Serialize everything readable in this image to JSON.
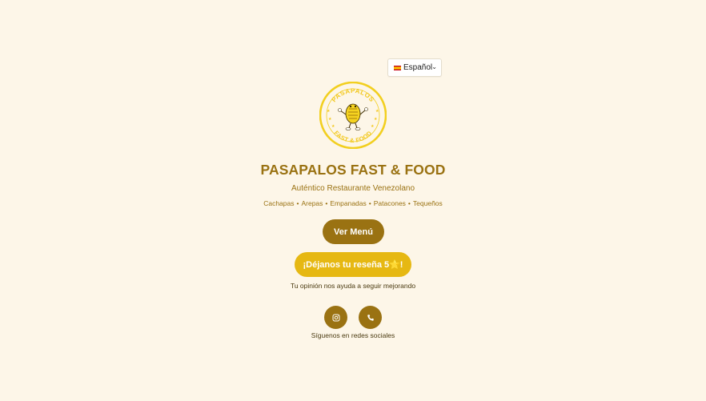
{
  "language_selector": {
    "flag_icon": "spain-flag-icon",
    "selected": "Español",
    "chevron_icon": "chevron-down-icon"
  },
  "logo": {
    "top_text": "PASAPALOS",
    "bottom_text": "FAST & FOOD",
    "icon": "mascot-logo-icon"
  },
  "brand": {
    "title": "PASAPALOS FAST & FOOD",
    "tagline": "Auténtico Restaurante Venezolano",
    "items": [
      "Cachapas",
      "Arepas",
      "Empanadas",
      "Patacones",
      "Tequeños"
    ]
  },
  "actions": {
    "menu_label": "Ver Menú",
    "review_label": "¡Déjanos tu reseña 5⭐!",
    "review_note": "Tu opinión nos ayuda a seguir mejorando"
  },
  "social": {
    "instagram_icon": "instagram-icon",
    "phone_icon": "phone-icon",
    "label": "Síguenos en redes sociales"
  },
  "colors": {
    "background": "#fdf6e8",
    "brand_brown": "#9a7212",
    "brand_yellow": "#e6b812",
    "logo_yellow": "#f2cf1f"
  }
}
